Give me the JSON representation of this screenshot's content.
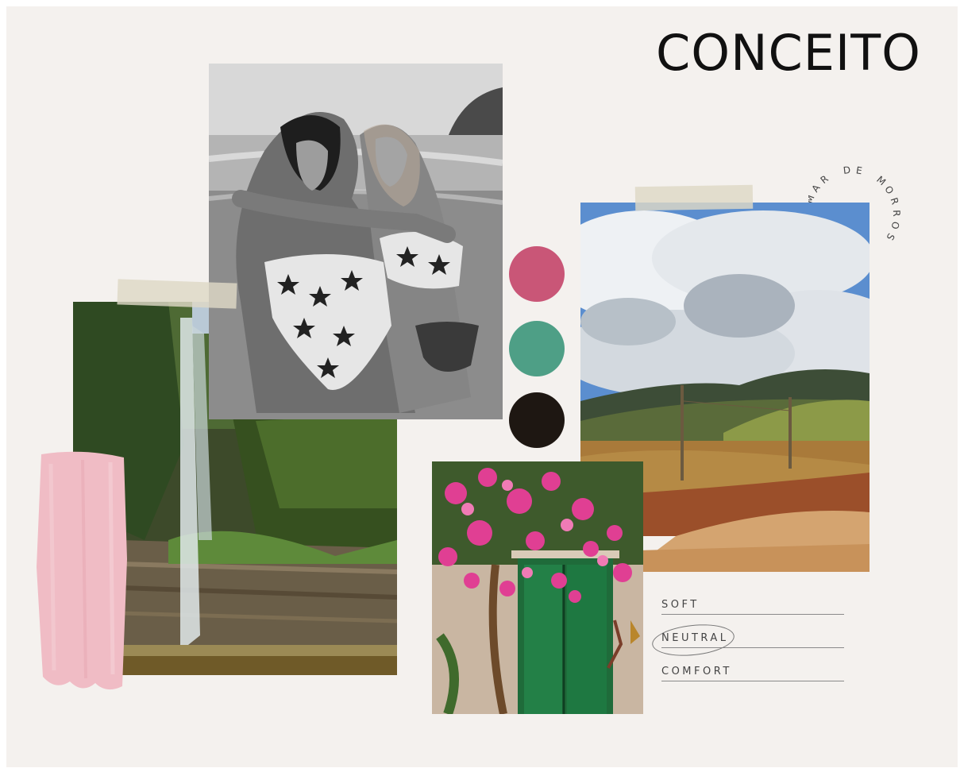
{
  "title": "CONCEITO",
  "arc_text": "DE MORROS MAR",
  "arc_text_parts": [
    "M",
    "A",
    "R",
    " ",
    "D",
    "E",
    " ",
    "M",
    "O",
    "R",
    "R",
    "O",
    "S"
  ],
  "palette": {
    "pink": "#c95677",
    "teal": "#4e9f86",
    "dark": "#1e1712"
  },
  "keywords": [
    "SOFT",
    "NEUTRAL",
    "COMFORT"
  ],
  "highlighted_keyword": "NEUTRAL",
  "photos": [
    {
      "name": "beach-women-photo",
      "subject": "black-and-white photo of two women in star print swimwear at the beach"
    },
    {
      "name": "waterfall-photo",
      "subject": "waterfall in green forest"
    },
    {
      "name": "landscape-photo",
      "subject": "cloudy sky over hills and dirt road"
    },
    {
      "name": "bougainvillea-door-photo",
      "subject": "pink bougainvillea over a green wooden door"
    }
  ],
  "brush_color": "#f0bcc5"
}
